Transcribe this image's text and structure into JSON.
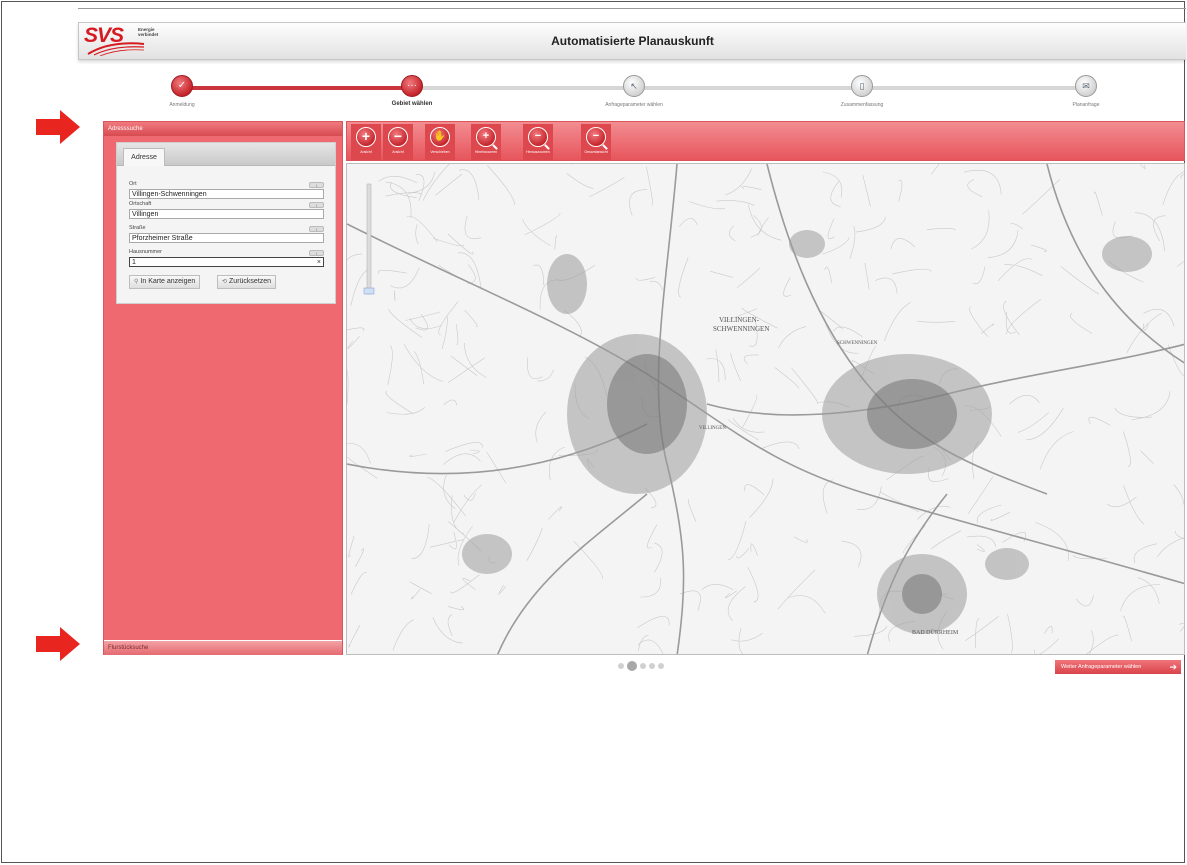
{
  "header": {
    "title": "Automatisierte Planauskunft"
  },
  "logo": {
    "text": "SVS",
    "sub": "Energie\nverbindet"
  },
  "wizard": {
    "steps": [
      {
        "label": "Anmeldung",
        "state": "done",
        "glyph": "✓"
      },
      {
        "label": "Gebiet wählen",
        "state": "active",
        "glyph": "···"
      },
      {
        "label": "Anfrageparameter wählen",
        "state": "todo",
        "glyph": "↖"
      },
      {
        "label": "Zusammenfassung",
        "state": "todo",
        "glyph": "▯"
      },
      {
        "label": "Plananfrage",
        "state": "todo",
        "glyph": "✉"
      }
    ]
  },
  "left_panel": {
    "header": "Adresssuche",
    "footer": "Flurstücksuche",
    "tab": "Adresse",
    "fields": [
      {
        "label": "Ort",
        "value": "Villingen-Schwenningen"
      },
      {
        "label": "Ortschaft",
        "value": "Villingen"
      },
      {
        "label": "Straße",
        "value": "Pforzheimer Straße"
      },
      {
        "label": "Hausnummer",
        "value": "1"
      }
    ],
    "clear_symbol": "×",
    "buttons": {
      "show_on_map": "In Karte anzeigen",
      "reset": "Zurücksetzen"
    }
  },
  "toolbar": {
    "tools": [
      {
        "label": "Ansicht",
        "icon": "plus-icon"
      },
      {
        "label": "Ansicht",
        "icon": "minus-icon"
      },
      {
        "label": "Verschieben",
        "icon": "hand-icon"
      },
      {
        "label": "Hineinzoomen",
        "icon": "zoom-in-icon"
      },
      {
        "label": "Herauszoomen",
        "icon": "zoom-out-icon"
      },
      {
        "label": "Gesamtansicht",
        "icon": "zoom-extent-icon"
      }
    ]
  },
  "map": {
    "labels": [
      {
        "text": "VILLINGEN-"
      },
      {
        "text": "SCHWENNINGEN"
      },
      {
        "text": "SCHWENNINGEN"
      },
      {
        "text": "VILLINGEN"
      },
      {
        "text": "BAD DÜRRHEIM"
      }
    ]
  },
  "pager": {
    "pages": 5,
    "current": 2
  },
  "next_button": {
    "label": "Weiter Anfrageparameter wählen",
    "arrow": "➔"
  },
  "colors": {
    "accent": "#e7555c",
    "accent_dark": "#c4242b",
    "brand": "#d71920"
  }
}
